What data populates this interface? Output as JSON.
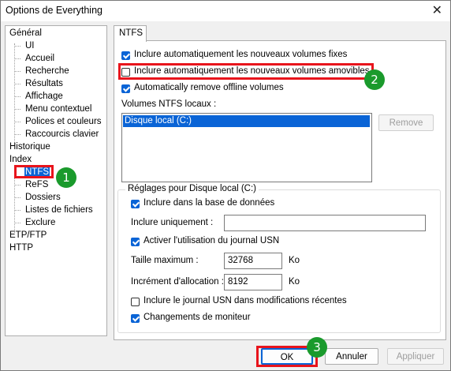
{
  "window": {
    "title": "Options de Everything",
    "close_glyph": "✕"
  },
  "tree": {
    "items": [
      "Général",
      "UI",
      "Accueil",
      "Recherche",
      "Résultats",
      "Affichage",
      "Menu contextuel",
      "Polices et couleurs",
      "Raccourcis clavier",
      "Historique",
      "Index",
      "NTFS",
      "ReFS",
      "Dossiers",
      "Listes de fichiers",
      "Exclure",
      "ETP/FTP",
      "HTTP"
    ],
    "selected": "NTFS"
  },
  "tab": {
    "label": "NTFS"
  },
  "ntfs": {
    "include_fixed": {
      "label": "Inclure automatiquement les nouveaux volumes fixes",
      "checked": true
    },
    "include_removable": {
      "label": "Inclure automatiquement les nouveaux volumes amovibles",
      "checked": false
    },
    "auto_remove": {
      "label": "Automatically remove offline volumes",
      "checked": true
    },
    "volumes_label": "Volumes NTFS locaux :",
    "volumes": [
      "Disque local (C:)"
    ],
    "remove_button": "Remove"
  },
  "settings": {
    "group_label": "Réglages pour Disque local (C:)",
    "include_db": {
      "label": "Inclure dans la base de données",
      "checked": true
    },
    "include_only_label": "Inclure uniquement :",
    "include_only_value": "",
    "usn_journal": {
      "label": "Activer l'utilisation du journal USN",
      "checked": true
    },
    "max_size_label": "Taille maximum :",
    "max_size_value": "32768",
    "max_size_unit": "Ko",
    "alloc_label": "Incrément d'allocation :",
    "alloc_value": "8192",
    "alloc_unit": "Ko",
    "usn_recent": {
      "label": "Inclure le journal USN dans modifications récentes",
      "checked": false
    },
    "monitor_changes": {
      "label": "Changements de moniteur",
      "checked": true
    }
  },
  "buttons": {
    "ok": "OK",
    "cancel": "Annuler",
    "apply": "Appliquer"
  },
  "annotations": {
    "badge1": "1",
    "badge2": "2",
    "badge3": "3",
    "highlight_color": "#e8141c",
    "badge_color": "#1a9a2c"
  }
}
